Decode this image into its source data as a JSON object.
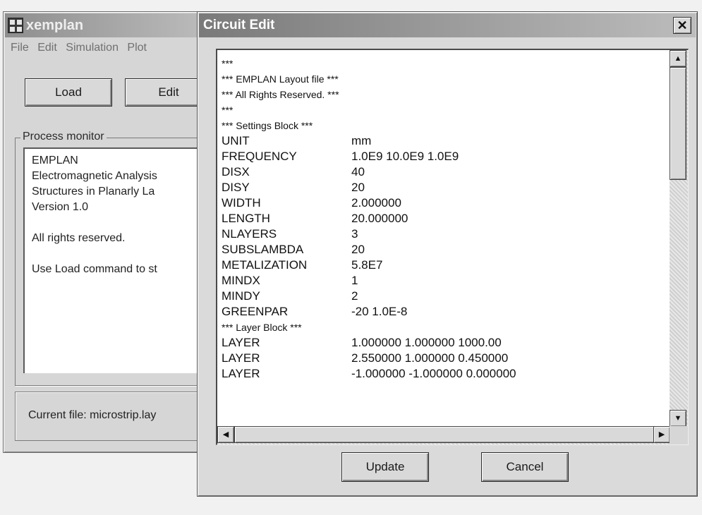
{
  "back_window": {
    "title": "xemplan",
    "menu": [
      "File",
      "Edit",
      "Simulation",
      "Plot"
    ],
    "buttons": {
      "load": "Load",
      "edit": "Edit"
    },
    "process_monitor": {
      "label": "Process monitor",
      "lines": [
        "EMPLAN",
        "Electromagnetic Analysis",
        "Structures in Planarly La",
        "Version 1.0",
        "",
        "All rights reserved.",
        "",
        "Use Load command to st"
      ]
    },
    "status": "Current file: microstrip.lay"
  },
  "dialog": {
    "title": "Circuit Edit",
    "close_glyph": "✕",
    "update_label": "Update",
    "cancel_label": "Cancel",
    "editor_lines": [
      {
        "k": "***",
        "v": "",
        "small": true
      },
      {
        "k": "*** EMPLAN Layout file ***",
        "v": "",
        "small": true
      },
      {
        "k": "*** All Rights Reserved. ***",
        "v": "",
        "small": true
      },
      {
        "k": "***",
        "v": "",
        "small": true
      },
      {
        "k": "*** Settings Block ***",
        "v": "",
        "small": true
      },
      {
        "k": "UNIT",
        "v": "mm"
      },
      {
        "k": "FREQUENCY",
        "v": "1.0E9 10.0E9 1.0E9"
      },
      {
        "k": "DISX",
        "v": "40"
      },
      {
        "k": "DISY",
        "v": "20"
      },
      {
        "k": "WIDTH",
        "v": "2.000000"
      },
      {
        "k": "LENGTH",
        "v": "20.000000"
      },
      {
        "k": "NLAYERS",
        "v": "3"
      },
      {
        "k": "SUBSLAMBDA",
        "v": "20"
      },
      {
        "k": "METALIZATION",
        "v": "5.8E7"
      },
      {
        "k": "MINDX",
        "v": "1"
      },
      {
        "k": "MINDY",
        "v": "2"
      },
      {
        "k": "GREENPAR",
        "v": "-20 1.0E-8"
      },
      {
        "k": "*** Layer Block ***",
        "v": "",
        "small": true
      },
      {
        "k": "LAYER",
        "v": "1.000000 1.000000 1000.00"
      },
      {
        "k": "LAYER",
        "v": "2.550000 1.000000 0.450000"
      },
      {
        "k": "LAYER",
        "v": "-1.000000 -1.000000 0.000000"
      }
    ]
  }
}
